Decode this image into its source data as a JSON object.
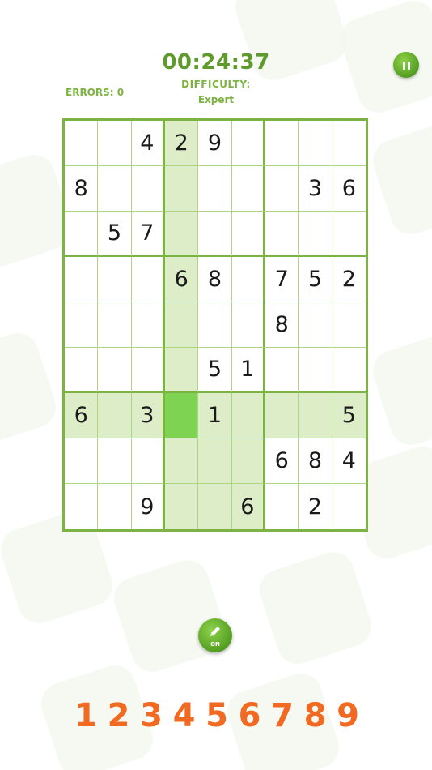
{
  "header": {
    "timer": "00:24:37",
    "difficulty_label": "DIFFICULTY:",
    "difficulty_value": "Expert",
    "errors": "ERRORS: 0"
  },
  "board": {
    "rows": [
      [
        "",
        "",
        "4",
        "2",
        "9",
        "",
        "",
        "",
        ""
      ],
      [
        "8",
        "",
        "",
        "",
        "",
        "",
        "",
        "3",
        "6"
      ],
      [
        "",
        "5",
        "7",
        "",
        "",
        "",
        "",
        "",
        ""
      ],
      [
        "",
        "",
        "",
        "6",
        "8",
        "",
        "7",
        "5",
        "2"
      ],
      [
        "",
        "",
        "",
        "",
        "",
        "",
        "8",
        "",
        ""
      ],
      [
        "",
        "",
        "",
        "",
        "5",
        "1",
        "",
        "",
        ""
      ],
      [
        "6",
        "",
        "3",
        "",
        "1",
        "",
        "",
        "",
        "5"
      ],
      [
        "",
        "",
        "",
        "",
        "",
        "",
        "6",
        "8",
        "4"
      ],
      [
        "",
        "",
        "9",
        "",
        "",
        "6",
        "",
        "2",
        ""
      ]
    ],
    "selected": [
      6,
      3
    ]
  },
  "pencil": {
    "label": "ON",
    "icon": "pencil-icon"
  },
  "numpad": [
    "1",
    "2",
    "3",
    "4",
    "5",
    "6",
    "7",
    "8",
    "9"
  ],
  "colors": {
    "accent": "#7cb342",
    "highlight": "#dcedc8",
    "selected": "#7ed352",
    "numpad": "#f26a21"
  }
}
